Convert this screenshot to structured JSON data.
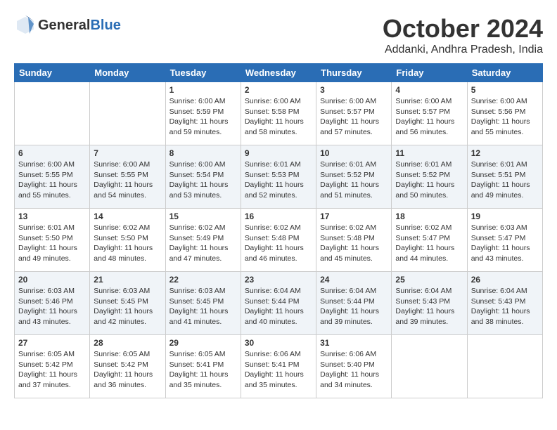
{
  "logo": {
    "general": "General",
    "blue": "Blue"
  },
  "title": "October 2024",
  "location": "Addanki, Andhra Pradesh, India",
  "days_header": [
    "Sunday",
    "Monday",
    "Tuesday",
    "Wednesday",
    "Thursday",
    "Friday",
    "Saturday"
  ],
  "weeks": [
    [
      {
        "day": "",
        "info": ""
      },
      {
        "day": "",
        "info": ""
      },
      {
        "day": "1",
        "info": "Sunrise: 6:00 AM\nSunset: 5:59 PM\nDaylight: 11 hours and 59 minutes."
      },
      {
        "day": "2",
        "info": "Sunrise: 6:00 AM\nSunset: 5:58 PM\nDaylight: 11 hours and 58 minutes."
      },
      {
        "day": "3",
        "info": "Sunrise: 6:00 AM\nSunset: 5:57 PM\nDaylight: 11 hours and 57 minutes."
      },
      {
        "day": "4",
        "info": "Sunrise: 6:00 AM\nSunset: 5:57 PM\nDaylight: 11 hours and 56 minutes."
      },
      {
        "day": "5",
        "info": "Sunrise: 6:00 AM\nSunset: 5:56 PM\nDaylight: 11 hours and 55 minutes."
      }
    ],
    [
      {
        "day": "6",
        "info": "Sunrise: 6:00 AM\nSunset: 5:55 PM\nDaylight: 11 hours and 55 minutes."
      },
      {
        "day": "7",
        "info": "Sunrise: 6:00 AM\nSunset: 5:55 PM\nDaylight: 11 hours and 54 minutes."
      },
      {
        "day": "8",
        "info": "Sunrise: 6:00 AM\nSunset: 5:54 PM\nDaylight: 11 hours and 53 minutes."
      },
      {
        "day": "9",
        "info": "Sunrise: 6:01 AM\nSunset: 5:53 PM\nDaylight: 11 hours and 52 minutes."
      },
      {
        "day": "10",
        "info": "Sunrise: 6:01 AM\nSunset: 5:52 PM\nDaylight: 11 hours and 51 minutes."
      },
      {
        "day": "11",
        "info": "Sunrise: 6:01 AM\nSunset: 5:52 PM\nDaylight: 11 hours and 50 minutes."
      },
      {
        "day": "12",
        "info": "Sunrise: 6:01 AM\nSunset: 5:51 PM\nDaylight: 11 hours and 49 minutes."
      }
    ],
    [
      {
        "day": "13",
        "info": "Sunrise: 6:01 AM\nSunset: 5:50 PM\nDaylight: 11 hours and 49 minutes."
      },
      {
        "day": "14",
        "info": "Sunrise: 6:02 AM\nSunset: 5:50 PM\nDaylight: 11 hours and 48 minutes."
      },
      {
        "day": "15",
        "info": "Sunrise: 6:02 AM\nSunset: 5:49 PM\nDaylight: 11 hours and 47 minutes."
      },
      {
        "day": "16",
        "info": "Sunrise: 6:02 AM\nSunset: 5:48 PM\nDaylight: 11 hours and 46 minutes."
      },
      {
        "day": "17",
        "info": "Sunrise: 6:02 AM\nSunset: 5:48 PM\nDaylight: 11 hours and 45 minutes."
      },
      {
        "day": "18",
        "info": "Sunrise: 6:02 AM\nSunset: 5:47 PM\nDaylight: 11 hours and 44 minutes."
      },
      {
        "day": "19",
        "info": "Sunrise: 6:03 AM\nSunset: 5:47 PM\nDaylight: 11 hours and 43 minutes."
      }
    ],
    [
      {
        "day": "20",
        "info": "Sunrise: 6:03 AM\nSunset: 5:46 PM\nDaylight: 11 hours and 43 minutes."
      },
      {
        "day": "21",
        "info": "Sunrise: 6:03 AM\nSunset: 5:45 PM\nDaylight: 11 hours and 42 minutes."
      },
      {
        "day": "22",
        "info": "Sunrise: 6:03 AM\nSunset: 5:45 PM\nDaylight: 11 hours and 41 minutes."
      },
      {
        "day": "23",
        "info": "Sunrise: 6:04 AM\nSunset: 5:44 PM\nDaylight: 11 hours and 40 minutes."
      },
      {
        "day": "24",
        "info": "Sunrise: 6:04 AM\nSunset: 5:44 PM\nDaylight: 11 hours and 39 minutes."
      },
      {
        "day": "25",
        "info": "Sunrise: 6:04 AM\nSunset: 5:43 PM\nDaylight: 11 hours and 39 minutes."
      },
      {
        "day": "26",
        "info": "Sunrise: 6:04 AM\nSunset: 5:43 PM\nDaylight: 11 hours and 38 minutes."
      }
    ],
    [
      {
        "day": "27",
        "info": "Sunrise: 6:05 AM\nSunset: 5:42 PM\nDaylight: 11 hours and 37 minutes."
      },
      {
        "day": "28",
        "info": "Sunrise: 6:05 AM\nSunset: 5:42 PM\nDaylight: 11 hours and 36 minutes."
      },
      {
        "day": "29",
        "info": "Sunrise: 6:05 AM\nSunset: 5:41 PM\nDaylight: 11 hours and 35 minutes."
      },
      {
        "day": "30",
        "info": "Sunrise: 6:06 AM\nSunset: 5:41 PM\nDaylight: 11 hours and 35 minutes."
      },
      {
        "day": "31",
        "info": "Sunrise: 6:06 AM\nSunset: 5:40 PM\nDaylight: 11 hours and 34 minutes."
      },
      {
        "day": "",
        "info": ""
      },
      {
        "day": "",
        "info": ""
      }
    ]
  ]
}
